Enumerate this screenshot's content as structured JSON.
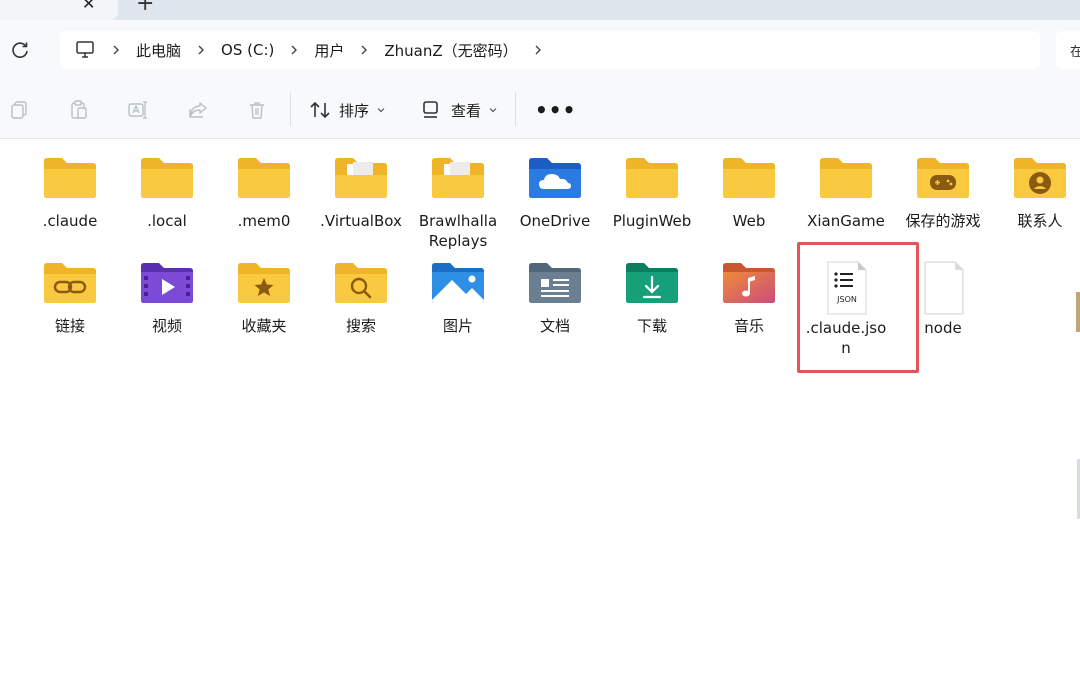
{
  "tabstrip": {
    "close_glyph": "✕",
    "new_tab_glyph": "+"
  },
  "breadcrumb": {
    "icon": "pc-icon",
    "items": [
      {
        "label": "此电脑"
      },
      {
        "label": "OS (C:)"
      },
      {
        "label": "用户"
      },
      {
        "label": "ZhuanZ（无密码）"
      }
    ],
    "search_edge_text": "在"
  },
  "toolbar": {
    "icons": [
      "copy-icon",
      "paste-icon",
      "rename-icon",
      "share-icon",
      "delete-icon"
    ],
    "sort_label": "排序",
    "view_label": "查看",
    "more_label": "•••"
  },
  "files": {
    "row1": [
      {
        "name": ".claude",
        "icon": "folder-icon"
      },
      {
        "name": ".local",
        "icon": "folder-icon"
      },
      {
        "name": ".mem0",
        "icon": "folder-icon"
      },
      {
        "name": ".VirtualBox",
        "icon": "folder-with-files-icon"
      },
      {
        "name": "Brawlhalla Replays",
        "icon": "folder-with-files-icon"
      },
      {
        "name": "OneDrive",
        "icon": "onedrive-folder-icon"
      },
      {
        "name": "PluginWeb",
        "icon": "folder-icon"
      },
      {
        "name": "Web",
        "icon": "folder-icon"
      },
      {
        "name": "XianGame",
        "icon": "folder-icon"
      },
      {
        "name": "保存的游戏",
        "icon": "saved-games-folder-icon"
      },
      {
        "name": "联系人",
        "icon": "contacts-folder-icon"
      }
    ],
    "row2": [
      {
        "name": "链接",
        "icon": "links-folder-icon"
      },
      {
        "name": "视频",
        "icon": "videos-folder-icon"
      },
      {
        "name": "收藏夹",
        "icon": "favorites-folder-icon"
      },
      {
        "name": "搜索",
        "icon": "searches-folder-icon"
      },
      {
        "name": "图片",
        "icon": "pictures-folder-icon"
      },
      {
        "name": "文档",
        "icon": "documents-folder-icon"
      },
      {
        "name": "下载",
        "icon": "downloads-folder-icon"
      },
      {
        "name": "音乐",
        "icon": "music-folder-icon"
      },
      {
        "name": ".claude.json",
        "icon": "json-file-icon"
      },
      {
        "name": "node",
        "icon": "blank-file-icon"
      }
    ]
  },
  "colors": {
    "folder": "#f9c940",
    "folder_back": "#f0b429",
    "highlight": "#e5535b",
    "onedrive": "#2b7be3",
    "videos": "#7b4bd6",
    "pictures": "#2f8fe4",
    "documents": "#6b7f93",
    "downloads": "#15a07a",
    "music": "#e0704f"
  }
}
